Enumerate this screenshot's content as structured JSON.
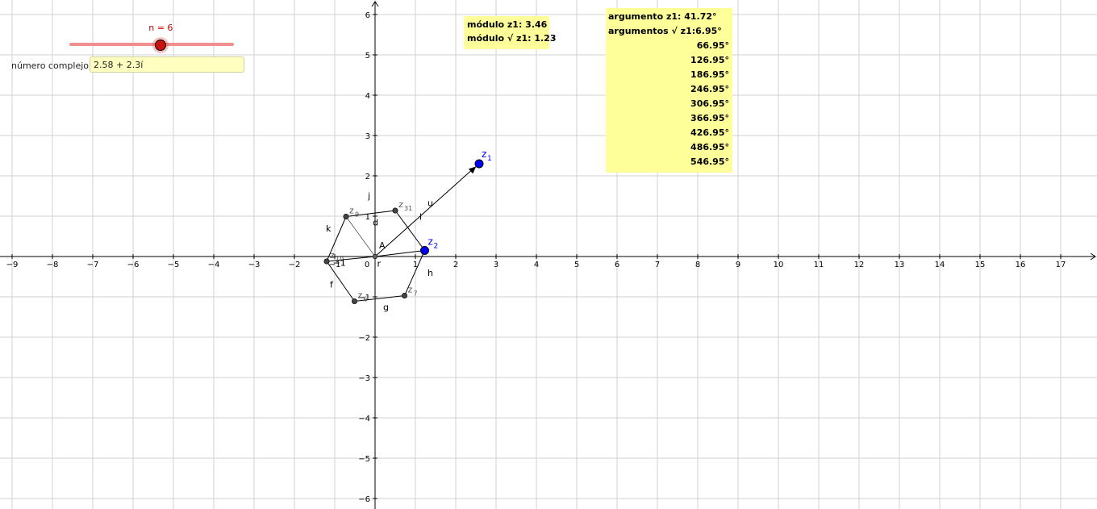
{
  "slider": {
    "label": "n = 6",
    "value": 6,
    "min": 1,
    "max": 10
  },
  "complex_input": {
    "label": "número complejo:",
    "value": "2.58 + 2.3í"
  },
  "modulus_box": {
    "line1": "módulo z1: 3.46",
    "line2": "módulo √ z1: 1.23"
  },
  "argument_box": {
    "title": "argumento z1: 41.72°",
    "subtitle": "argumentos √ z1:6.95°",
    "values": [
      "66.95°",
      "126.95°",
      "186.95°",
      "246.95°",
      "306.95°",
      "366.95°",
      "426.95°",
      "486.95°",
      "546.95°"
    ]
  },
  "axes": {
    "x_ticks": [
      "−9",
      "−8",
      "−7",
      "−6",
      "−5",
      "−4",
      "−3",
      "−2",
      "−1",
      "0",
      "1",
      "2",
      "3",
      "4",
      "5",
      "6",
      "7",
      "8",
      "9",
      "10",
      "11",
      "12",
      "13",
      "14",
      "15",
      "16",
      "17"
    ],
    "y_ticks": [
      "6",
      "5",
      "4",
      "3",
      "2",
      "1",
      "−1",
      "−2",
      "−3",
      "−4",
      "−5",
      "−6"
    ]
  },
  "colors": {
    "grid": "#d0d0d0",
    "axis": "#000000",
    "point_blue": "#0000ff",
    "point_gray": "#444444",
    "highlight": "#ffff99",
    "slider_red": "#cc0000"
  },
  "geometry_data": {
    "z1": [
      2.58,
      2.3
    ],
    "origin": [
      0,
      0
    ],
    "z2": [
      1.23,
      0.15
    ],
    "polygon": [
      {
        "name": "z2",
        "pt": [
          1.23,
          0.15
        ],
        "label": "z2",
        "label_sub": "2"
      },
      {
        "name": "z31",
        "pt": [
          0.5,
          1.14
        ],
        "label": "z",
        "label_sub": "31"
      },
      {
        "name": "z9",
        "pt": [
          -0.72,
          0.99
        ],
        "label": "z",
        "label_sub": "9"
      },
      {
        "name": "z10",
        "pt": [
          -1.2,
          -0.12
        ],
        "label": "z",
        "label_sub": "10"
      },
      {
        "name": "z6",
        "pt": [
          -0.51,
          -1.11
        ],
        "label": "z",
        "label_sub": "6"
      },
      {
        "name": "z7",
        "pt": [
          0.73,
          -0.97
        ],
        "label": "z",
        "label_sub": "7"
      }
    ],
    "segment_labels": [
      {
        "text": "j",
        "at": [
          -0.18,
          1.43
        ]
      },
      {
        "text": "k",
        "at": [
          -1.22,
          0.62
        ]
      },
      {
        "text": "l",
        "at": [
          1.1,
          0.91
        ]
      },
      {
        "text": "d",
        "at": [
          -0.06,
          0.77
        ]
      },
      {
        "text": "u",
        "at": [
          1.3,
          1.25
        ]
      },
      {
        "text": "f",
        "at": [
          -1.12,
          -0.77
        ]
      },
      {
        "text": "g",
        "at": [
          0.2,
          -1.33
        ]
      },
      {
        "text": "h",
        "at": [
          1.3,
          -0.48
        ]
      },
      {
        "text": "r",
        "at": [
          0.05,
          -0.25
        ]
      },
      {
        "text": "A",
        "at": [
          0.1,
          0.2
        ]
      },
      {
        "text": "−1",
        "at": [
          -1.05,
          -0.23
        ]
      }
    ]
  }
}
